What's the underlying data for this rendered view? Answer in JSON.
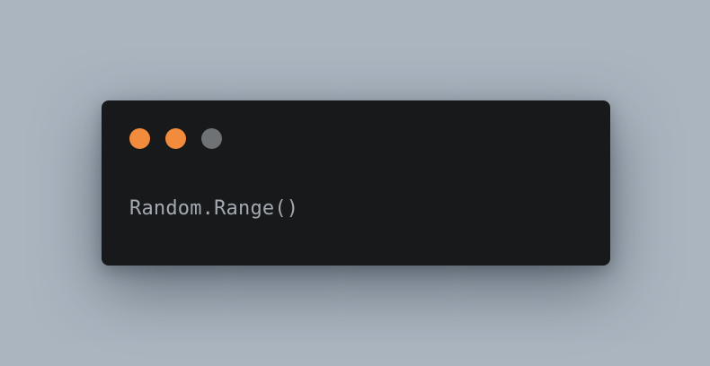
{
  "colors": {
    "background": "#abb5c0",
    "window": "#18191b",
    "code_text": "#a3a9b1"
  },
  "window": {
    "controls": [
      {
        "name": "close-dot",
        "color": "#f28b3c"
      },
      {
        "name": "minimize-dot",
        "color": "#f28b3c"
      },
      {
        "name": "maximize-dot",
        "color": "#6e7275"
      }
    ],
    "code": "Random.Range()"
  }
}
